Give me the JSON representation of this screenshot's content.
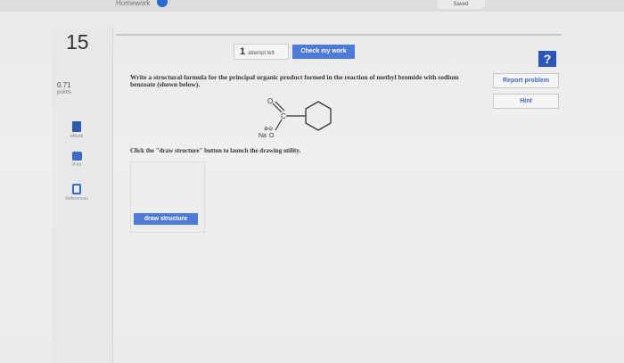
{
  "header": {
    "crumb_text": "Homework",
    "saved_label": "Saved"
  },
  "sidebar": {
    "question_number": "15",
    "points_value": "0.71",
    "points_label": "points",
    "tools": [
      {
        "label": "eBook",
        "icon": "ebook-icon"
      },
      {
        "label": "Print",
        "icon": "print-icon"
      },
      {
        "label": "References",
        "icon": "references-icon"
      }
    ]
  },
  "toolbar": {
    "attempts_count": "1",
    "attempts_label": "attempt left",
    "check_work_label": "Check my work"
  },
  "side_buttons": {
    "help_label": "?",
    "report_problem_label": "Report problem",
    "hint_label": "Hint"
  },
  "question": {
    "text": "Write a structural formula for the principal organic product formed in the reaction of methyl bromide with sodium benzoate (shown below).",
    "molecule": {
      "atom_o": "O",
      "atom_c": "C",
      "atom_o_minus": "O",
      "counter_ion": "Na",
      "charges": "⊕⊖"
    },
    "instruction": "Click the \"draw structure\" button to launch the drawing utility.",
    "draw_structure_label": "draw structure"
  },
  "colors": {
    "accent_blue": "#4c7bd8",
    "help_blue": "#2b56b7",
    "background": "#ececec"
  }
}
